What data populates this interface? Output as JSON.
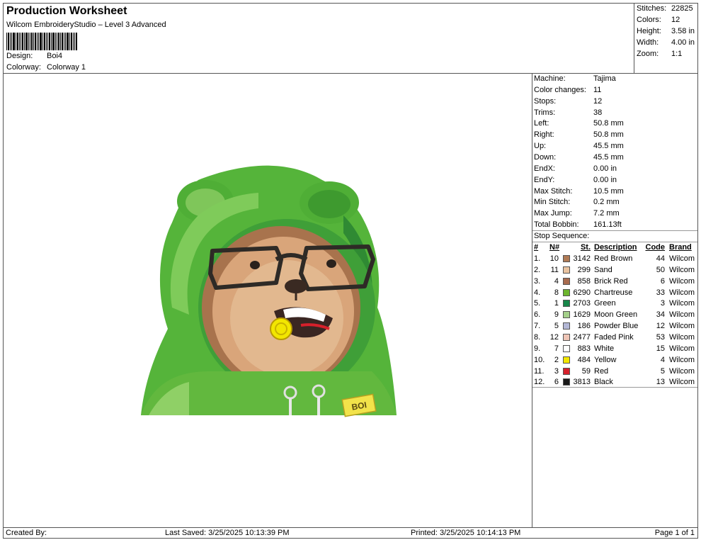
{
  "header": {
    "title": "Production Worksheet",
    "subtitle": "Wilcom EmbroideryStudio – Level 3 Advanced",
    "design_label": "Design:",
    "design_value": "Boi4",
    "colorway_label": "Colorway:",
    "colorway_value": "Colorway 1"
  },
  "stats": [
    {
      "label": "Stitches:",
      "value": "22825"
    },
    {
      "label": "Colors:",
      "value": "12"
    },
    {
      "label": "Height:",
      "value": "3.58 in"
    },
    {
      "label": "Width:",
      "value": "4.00 in"
    },
    {
      "label": "Zoom:",
      "value": "1:1"
    }
  ],
  "machine_info": [
    {
      "label": "Machine:",
      "value": "Tajima"
    },
    {
      "label": "Color changes:",
      "value": "11"
    },
    {
      "label": "Stops:",
      "value": "12"
    },
    {
      "label": "Trims:",
      "value": "38"
    },
    {
      "label": "Left:",
      "value": "50.8 mm"
    },
    {
      "label": "Right:",
      "value": "50.8 mm"
    },
    {
      "label": "Up:",
      "value": "45.5 mm"
    },
    {
      "label": "Down:",
      "value": "45.5 mm"
    },
    {
      "label": "EndX:",
      "value": "0.00 in"
    },
    {
      "label": "EndY:",
      "value": "0.00 in"
    },
    {
      "label": "Max Stitch:",
      "value": "10.5 mm"
    },
    {
      "label": "Min Stitch:",
      "value": "0.2 mm"
    },
    {
      "label": "Max Jump:",
      "value": "7.2 mm"
    },
    {
      "label": "Total Bobbin:",
      "value": "161.13ft"
    }
  ],
  "stop_sequence": {
    "label": "Stop Sequence:",
    "columns": {
      "num": "#",
      "needle": "N#",
      "stitches": "St.",
      "description": "Description",
      "code": "Code",
      "brand": "Brand"
    },
    "rows": [
      {
        "num": "1.",
        "needle": "10",
        "color": "#b07a55",
        "stitches": "3142",
        "description": "Red Brown",
        "code": "44",
        "brand": "Wilcom"
      },
      {
        "num": "2.",
        "needle": "11",
        "color": "#e9c3a0",
        "stitches": "299",
        "description": "Sand",
        "code": "50",
        "brand": "Wilcom"
      },
      {
        "num": "3.",
        "needle": "4",
        "color": "#a86b4e",
        "stitches": "858",
        "description": "Brick Red",
        "code": "6",
        "brand": "Wilcom"
      },
      {
        "num": "4.",
        "needle": "8",
        "color": "#6cb52d",
        "stitches": "6290",
        "description": "Chartreuse",
        "code": "33",
        "brand": "Wilcom"
      },
      {
        "num": "5.",
        "needle": "1",
        "color": "#17874a",
        "stitches": "2703",
        "description": "Green",
        "code": "3",
        "brand": "Wilcom"
      },
      {
        "num": "6.",
        "needle": "9",
        "color": "#a4d08a",
        "stitches": "1629",
        "description": "Moon Green",
        "code": "34",
        "brand": "Wilcom"
      },
      {
        "num": "7.",
        "needle": "5",
        "color": "#b3b7d6",
        "stitches": "186",
        "description": "Powder Blue",
        "code": "12",
        "brand": "Wilcom"
      },
      {
        "num": "8.",
        "needle": "12",
        "color": "#efc5b6",
        "stitches": "2477",
        "description": "Faded Pink",
        "code": "53",
        "brand": "Wilcom"
      },
      {
        "num": "9.",
        "needle": "7",
        "color": "#ffffff",
        "stitches": "883",
        "description": "White",
        "code": "15",
        "brand": "Wilcom"
      },
      {
        "num": "10.",
        "needle": "2",
        "color": "#f2e600",
        "stitches": "484",
        "description": "Yellow",
        "code": "4",
        "brand": "Wilcom"
      },
      {
        "num": "11.",
        "needle": "3",
        "color": "#d7202b",
        "stitches": "59",
        "description": "Red",
        "code": "5",
        "brand": "Wilcom"
      },
      {
        "num": "12.",
        "needle": "6",
        "color": "#1a1a1a",
        "stitches": "3813",
        "description": "Black",
        "code": "13",
        "brand": "Wilcom"
      }
    ]
  },
  "design_preview": {
    "patch_text": "BOI"
  },
  "footer": {
    "created_by": "Created By:",
    "last_saved": "Last Saved: 3/25/2025 10:13:39 PM",
    "printed": "Printed: 3/25/2025 10:14:13 PM",
    "page": "Page 1 of 1"
  }
}
